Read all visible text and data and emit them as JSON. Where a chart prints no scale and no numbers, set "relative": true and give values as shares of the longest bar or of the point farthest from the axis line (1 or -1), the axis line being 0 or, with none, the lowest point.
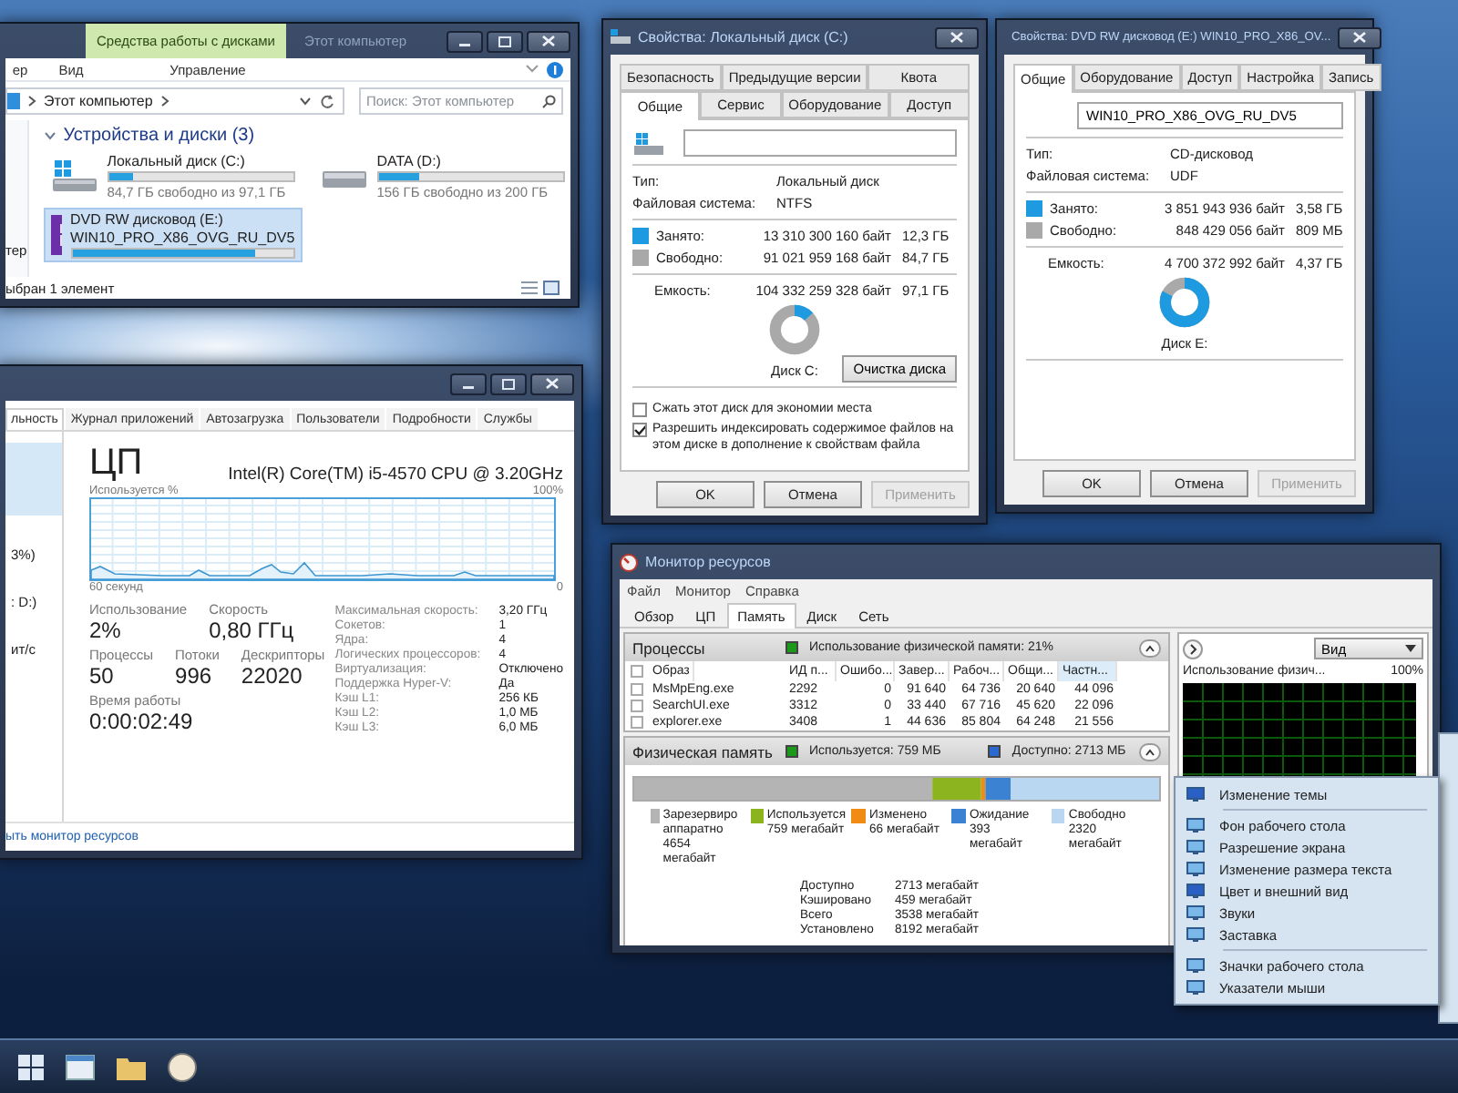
{
  "explorer": {
    "tabs": [
      {
        "label": "Средства работы с дисками",
        "kind": "contextual"
      },
      {
        "label": "Этот компьютер",
        "kind": "title"
      }
    ],
    "ribbon": [
      "ер",
      "Вид",
      "Управление"
    ],
    "address": "Этот компьютер",
    "search": {
      "placeholder": "Поиск: Этот компьютер"
    },
    "nav_item": "тер",
    "group": "Устройства и диски (3)",
    "drives": [
      {
        "kind": "system",
        "name": "Локальный диск (C:)",
        "free": "84,7 ГБ свободно из 97,1 ГБ",
        "level": 0.13,
        "selected": false
      },
      {
        "kind": "hdd",
        "name": "DATA (D:)",
        "free": "156 ГБ свободно из 200 ГБ",
        "level": 0.22,
        "selected": false
      },
      {
        "kind": "dvd",
        "name": "DVD RW дисковод (E:)",
        "label": "WIN10_PRO_X86_OVG_RU_DV5",
        "level": 0.83,
        "selected": true
      }
    ],
    "status": "ыбран 1 элемент"
  },
  "disk_c_properties": {
    "title": "Свойства: Локальный диск (C:)",
    "tab_rows": [
      [
        {
          "label": "Безопасность",
          "selected": false
        },
        {
          "label": "Предыдущие версии",
          "selected": false
        },
        {
          "label": "Квота",
          "selected": false
        }
      ],
      [
        {
          "label": "Общие",
          "selected": true
        },
        {
          "label": "Сервис",
          "selected": false
        },
        {
          "label": "Оборудование",
          "selected": false
        },
        {
          "label": "Доступ",
          "selected": false
        }
      ]
    ],
    "info": [
      {
        "label": "Тип:",
        "value": "Локальный диск"
      },
      {
        "label": "Файловая система:",
        "value": "NTFS"
      }
    ],
    "usage": [
      {
        "label": "Занято:",
        "bytes": "13 310 300 160 байт",
        "size": "12,3 ГБ",
        "color": "#1e9be0"
      },
      {
        "label": "Свободно:",
        "bytes": "91 021 959 168 байт",
        "size": "84,7 ГБ",
        "color": "#a9a9a9"
      }
    ],
    "capacity": {
      "label": "Емкость:",
      "bytes": "104 332 259 328 байт",
      "size": "97,1 ГБ"
    },
    "donut": {
      "level": 0.13,
      "label": "Диск C:"
    },
    "cleanup_button": "Очистка диска",
    "checkboxes": [
      {
        "label": "Сжать этот диск для экономии места",
        "checked": false
      },
      {
        "label": "Разрешить индексировать содержимое файлов на этом диске в дополнение к свойствам файла",
        "checked": true
      }
    ],
    "buttons": [
      {
        "label": "OK",
        "disabled": false
      },
      {
        "label": "Отмена",
        "disabled": false
      },
      {
        "label": "Применить",
        "disabled": true
      }
    ]
  },
  "dvd_properties": {
    "title": "Свойства: DVD RW дисковод (E:) WIN10_PRO_X86_OV...",
    "tab_rows": [
      [
        {
          "label": "Общие",
          "selected": true
        },
        {
          "label": "Оборудование",
          "selected": false
        },
        {
          "label": "Доступ",
          "selected": false
        },
        {
          "label": "Настройка",
          "selected": false
        },
        {
          "label": "Запись",
          "selected": false
        }
      ]
    ],
    "name_value": "WIN10_PRO_X86_OVG_RU_DV5",
    "info": [
      {
        "label": "Тип:",
        "value": "CD-дисковод"
      },
      {
        "label": "Файловая система:",
        "value": "UDF"
      }
    ],
    "usage": [
      {
        "label": "Занято:",
        "bytes": "3 851 943 936 байт",
        "size": "3,58 ГБ",
        "color": "#1e9be0"
      },
      {
        "label": "Свободно:",
        "bytes": "848 429 056 байт",
        "size": "809 МБ",
        "color": "#a9a9a9"
      }
    ],
    "capacity": {
      "label": "Емкость:",
      "bytes": "4 700 372 992 байт",
      "size": "4,37 ГБ"
    },
    "donut": {
      "level": 0.82,
      "label": "Диск E:"
    },
    "buttons": [
      {
        "label": "OK",
        "disabled": false
      },
      {
        "label": "Отмена",
        "disabled": false
      },
      {
        "label": "Применить",
        "disabled": true
      }
    ]
  },
  "task_manager": {
    "tabs": [
      {
        "label": "льность",
        "selected": true
      },
      {
        "label": "Журнал приложений",
        "selected": false
      },
      {
        "label": "Автозагрузка",
        "selected": false
      },
      {
        "label": "Пользователи",
        "selected": false
      },
      {
        "label": "Подробности",
        "selected": false
      },
      {
        "label": "Службы",
        "selected": false
      }
    ],
    "sidebar": [
      "3%)",
      ": D:)",
      "ит/с"
    ],
    "heading": "ЦП",
    "cpu_model": "Intel(R) Core(TM) i5-4570 CPU @ 3.20GHz",
    "graph_label": "Используется %",
    "graph_max": "100%",
    "graph_span": "60 секунд",
    "graph_min": "0",
    "stats": [
      [
        {
          "label": "Использование",
          "value": "2%"
        },
        {
          "label": "Скорость",
          "value": "0,80 ГГц"
        }
      ],
      [
        {
          "label": "Процессы",
          "value": "50"
        },
        {
          "label": "Потоки",
          "value": "996"
        },
        {
          "label": "Дескрипторы",
          "value": "22020"
        }
      ],
      [
        {
          "label": "Время работы",
          "value": "0:00:02:49"
        }
      ]
    ],
    "specs": [
      {
        "label": "Максимальная скорость:",
        "value": "3,20 ГГц"
      },
      {
        "label": "Сокетов:",
        "value": "1"
      },
      {
        "label": "Ядра:",
        "value": "4"
      },
      {
        "label": "Логических процессоров:",
        "value": "4"
      },
      {
        "label": "Виртуализация:",
        "value": "Отключено"
      },
      {
        "label": "Поддержка Hyper-V:",
        "value": "Да"
      },
      {
        "label": "Кэш L1:",
        "value": "256 КБ"
      },
      {
        "label": "Кэш L2:",
        "value": "1,0 МБ"
      },
      {
        "label": "Кэш L3:",
        "value": "6,0 МБ"
      }
    ],
    "link": "ыть монитор ресурсов"
  },
  "resource_monitor": {
    "title": "Монитор ресурсов",
    "menu": [
      "Файл",
      "Монитор",
      "Справка"
    ],
    "tabs": [
      {
        "label": "Обзор",
        "selected": false
      },
      {
        "label": "ЦП",
        "selected": false
      },
      {
        "label": "Память",
        "selected": true
      },
      {
        "label": "Диск",
        "selected": false
      },
      {
        "label": "Сеть",
        "selected": false
      }
    ],
    "processes": {
      "title": "Процессы",
      "summary": "Использование физической памяти: 21%",
      "all_checked": false,
      "columns": [
        {
          "label": "Образ",
          "sorted": false
        },
        {
          "label": "ИД п...",
          "sorted": false
        },
        {
          "label": "Ошибо...",
          "sorted": false
        },
        {
          "label": "Завер...",
          "sorted": false
        },
        {
          "label": "Рабоч...",
          "sorted": false
        },
        {
          "label": "Общи...",
          "sorted": false
        },
        {
          "label": "Частн...",
          "sorted": true
        }
      ],
      "rows": [
        {
          "checked": false,
          "cells": [
            "MsMpEng.exe",
            "2292",
            "0",
            "91 640",
            "64 736",
            "20 640",
            "44 096"
          ]
        },
        {
          "checked": false,
          "cells": [
            "SearchUI.exe",
            "3312",
            "0",
            "33 440",
            "67 716",
            "45 620",
            "22 096"
          ]
        },
        {
          "checked": false,
          "cells": [
            "explorer.exe",
            "3408",
            "1",
            "44 636",
            "85 804",
            "64 248",
            "21 556"
          ]
        }
      ]
    },
    "memory": {
      "title": "Физическая память",
      "used": "Используется: 759 МБ",
      "available": "Доступно: 2713 МБ",
      "chart_data": {
        "type": "bar",
        "orientation": "horizontal",
        "stacked": true,
        "relative": true,
        "series": [
          {
            "color": "#b4b4b4",
            "values": [
              0.568
            ]
          },
          {
            "color": "#8cb41e",
            "values": [
              0.093
            ]
          },
          {
            "color": "#f08c14",
            "values": [
              0.008
            ]
          },
          {
            "color": "#3c82d2",
            "values": [
              0.048
            ]
          },
          {
            "color": "#b9d7f0",
            "values": [
              0.283
            ]
          }
        ]
      },
      "legend": [
        {
          "label": "Зарезервиро аппаратно",
          "value": "4654 мегабайт",
          "color": "#b4b4b4"
        },
        {
          "label": "Используется",
          "value": "759 мегабайт",
          "color": "#8cb41e"
        },
        {
          "label": "Изменено",
          "value": "66 мегабайт",
          "color": "#f08c14"
        },
        {
          "label": "Ожидание",
          "value": "393 мегабайт",
          "color": "#3c82d2"
        },
        {
          "label": "Свободно",
          "value": "2320 мегабайт",
          "color": "#b9d7f0"
        }
      ],
      "stats": [
        {
          "label": "Доступно",
          "value": "2713 мегабайт"
        },
        {
          "label": "Кэшировано",
          "value": "459 мегабайт"
        },
        {
          "label": "Всего",
          "value": "3538 мегабайт"
        },
        {
          "label": "Установлено",
          "value": "8192 мегабайт"
        }
      ]
    },
    "view_button": "Вид",
    "graph_label": "Использование физич...",
    "graph_max": "100%"
  },
  "context_menu": {
    "groups": [
      [
        "Изменение темы"
      ],
      [
        "Фон рабочего стола",
        "Разрешение экрана",
        "Изменение размера текста",
        "Цвет и внешний вид",
        "Звуки",
        "Заставка"
      ],
      [
        "Значки рабочего стола",
        "Указатели мыши"
      ]
    ]
  }
}
